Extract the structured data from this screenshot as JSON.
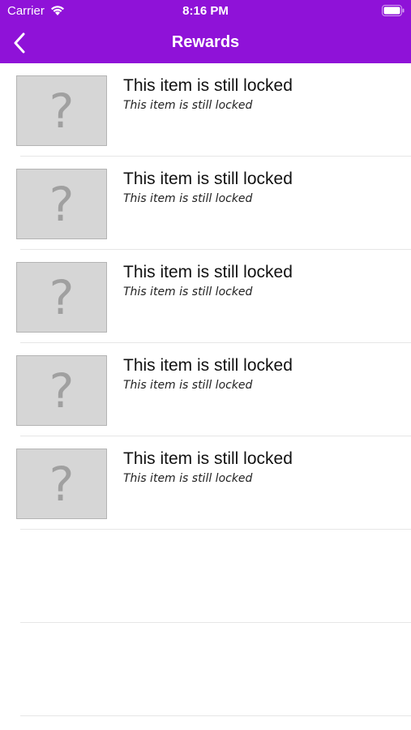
{
  "status_bar": {
    "carrier": "Carrier",
    "time": "8:16 PM",
    "wifi_icon": "wifi-icon",
    "battery_icon": "battery-icon"
  },
  "nav": {
    "title": "Rewards",
    "back_icon": "chevron-left-icon",
    "background_color": "#8f12d8"
  },
  "items": [
    {
      "placeholder": "?",
      "title": "This item is still locked",
      "subtitle": "This item is still locked"
    },
    {
      "placeholder": "?",
      "title": "This item is still locked",
      "subtitle": "This item is still locked"
    },
    {
      "placeholder": "?",
      "title": "This item is still locked",
      "subtitle": "This item is still locked"
    },
    {
      "placeholder": "?",
      "title": "This item is still locked",
      "subtitle": "This item is still locked"
    },
    {
      "placeholder": "?",
      "title": "This item is still locked",
      "subtitle": "This item is still locked"
    }
  ]
}
